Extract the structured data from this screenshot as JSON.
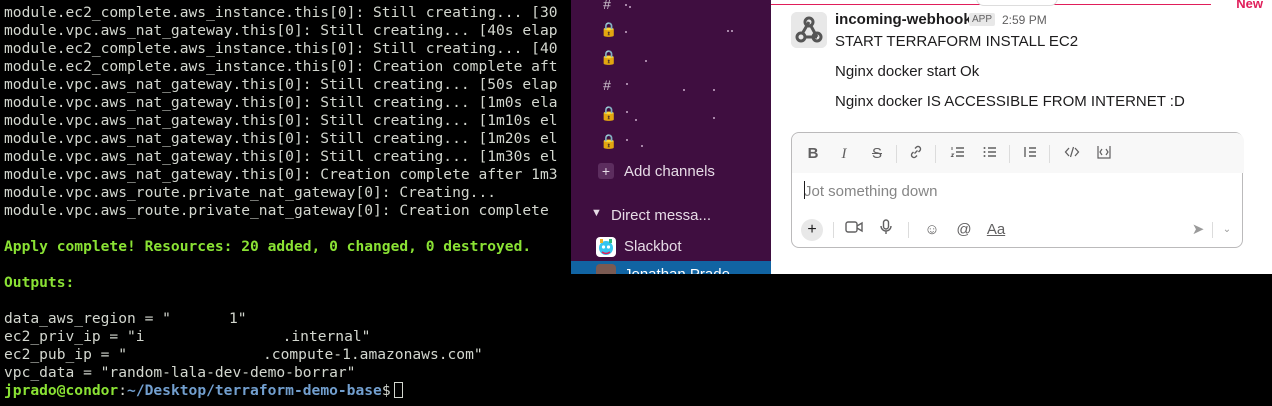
{
  "terminal": {
    "lines": [
      "module.ec2_complete.aws_instance.this[0]: Still creating... [30",
      "module.vpc.aws_nat_gateway.this[0]: Still creating... [40s elap",
      "module.ec2_complete.aws_instance.this[0]: Still creating... [40",
      "module.ec2_complete.aws_instance.this[0]: Creation complete aft",
      "module.vpc.aws_nat_gateway.this[0]: Still creating... [50s elap",
      "module.vpc.aws_nat_gateway.this[0]: Still creating... [1m0s ela",
      "module.vpc.aws_nat_gateway.this[0]: Still creating... [1m10s el",
      "module.vpc.aws_nat_gateway.this[0]: Still creating... [1m20s el",
      "module.vpc.aws_nat_gateway.this[0]: Still creating... [1m30s el",
      "module.vpc.aws_nat_gateway.this[0]: Creation complete after 1m3",
      "module.vpc.aws_route.private_nat_gateway[0]: Creating...",
      "module.vpc.aws_route.private_nat_gateway[0]: Creation complete "
    ],
    "apply_summary": "Apply complete! Resources: 20 added, 0 changed, 0 destroyed.",
    "outputs_label": "Outputs:",
    "outputs": {
      "region_prefix": "data_aws_region = \"",
      "region_suffix": "1\"",
      "priv_prefix": "ec2_priv_ip = \"i",
      "priv_suffix": ".internal\"",
      "pub_prefix": "ec2_pub_ip = \"",
      "pub_suffix": ".compute-1.amazonaws.com\"",
      "vpc_line": "vpc_data = \"random-lala-dev-demo-borrar\""
    },
    "prompt_user": "jprado@condor",
    "prompt_colon": ":",
    "prompt_path": "~/Desktop/terraform-demo-base",
    "prompt_symbol": "$"
  },
  "slack": {
    "sidebar": {
      "channel_icons": [
        "#",
        "🔒",
        "🔒",
        "#",
        "🔒",
        "🔒"
      ],
      "add_channels": "Add channels",
      "direct_messages": "Direct messa...",
      "slackbot": "Slackbot",
      "active_dm": "Jonathan Prado"
    },
    "new_marker": "New",
    "message": {
      "sender": "incoming-webhook",
      "badge": "APP",
      "time": "2:59 PM",
      "lines": [
        "START TERRAFORM INSTALL EC2",
        "Nginx docker start Ok",
        "Nginx docker IS ACCESSIBLE FROM INTERNET :D"
      ]
    },
    "composer": {
      "placeholder": "Jot something down"
    },
    "colors": {
      "sidebar_bg": "#3f0e40",
      "active_bg": "#1164a3",
      "new_marker": "#e01e5a",
      "terminal_green": "#8ae234",
      "terminal_blue": "#729fcf"
    }
  }
}
